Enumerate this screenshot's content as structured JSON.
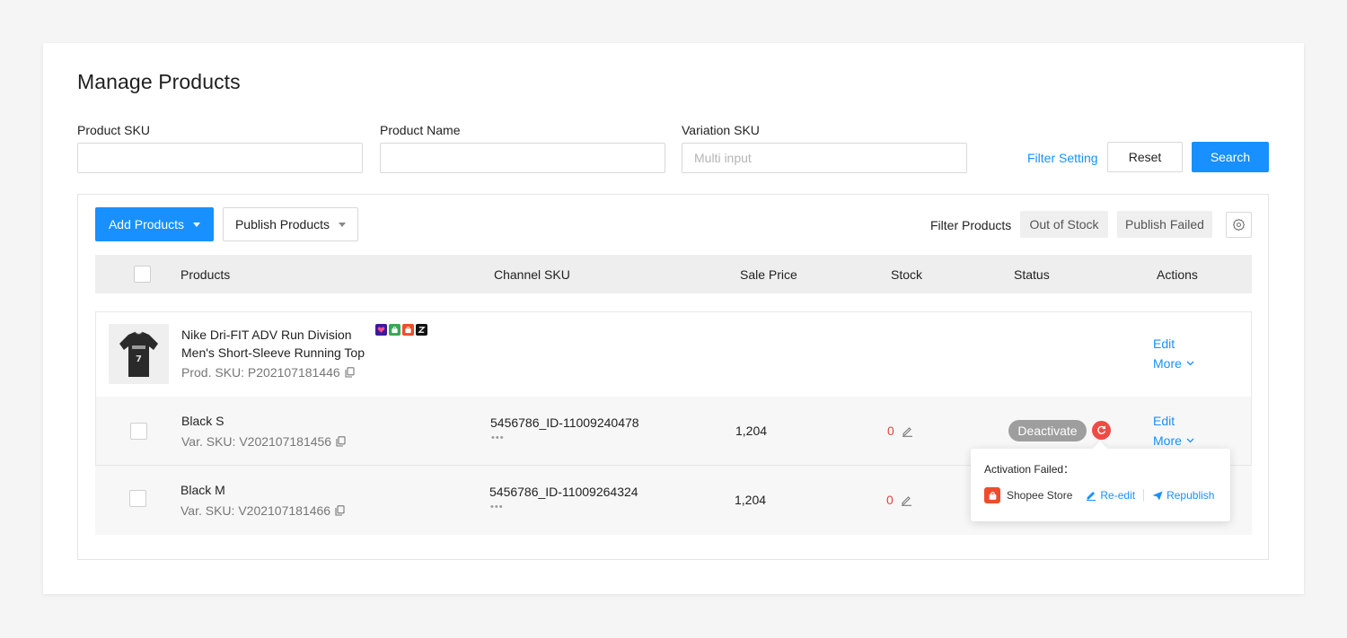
{
  "page": {
    "title": "Manage Products"
  },
  "filters": {
    "product_sku": {
      "label": "Product SKU",
      "value": "",
      "placeholder": ""
    },
    "product_name": {
      "label": "Product Name",
      "value": "",
      "placeholder": ""
    },
    "variation_sku": {
      "label": "Variation SKU",
      "value": "",
      "placeholder": "Multi input"
    },
    "filter_setting": "Filter Setting",
    "reset": "Reset",
    "search": "Search"
  },
  "toolbar": {
    "add_products": "Add Products",
    "publish_products": "Publish Products",
    "filter_label": "Filter Products",
    "chips": [
      "Out of Stock",
      "Publish Failed"
    ]
  },
  "table": {
    "columns": [
      "Products",
      "Channel SKU",
      "Sale Price",
      "Stock",
      "Status",
      "Actions"
    ]
  },
  "product": {
    "name_line1": "Nike Dri-FIT ADV Run Division",
    "name_line2": "Men's Short-Sleeve Running Top",
    "sku": "Prod. SKU: P202107181446",
    "channels": [
      "lazada-icon",
      "shop-bag-icon",
      "shopee-icon",
      "zalora-icon"
    ],
    "edit": "Edit",
    "more": "More"
  },
  "variations": [
    {
      "name": "Black S",
      "sku": "Var. SKU: V202107181456",
      "channel_sku": "5456786_ID-11009240478",
      "price": "1,204",
      "stock": "0",
      "status": "Deactivate",
      "edit": "Edit",
      "more": "More"
    },
    {
      "name": "Black M",
      "sku": "Var. SKU: V202107181466",
      "channel_sku": "5456786_ID-11009264324",
      "price": "1,204",
      "stock": "0"
    }
  ],
  "popover": {
    "title": "Activation Failed：",
    "store": "Shopee Store",
    "reedit": "Re-edit",
    "republish": "Republish"
  },
  "colors": {
    "primary": "#1890ff",
    "danger": "#e8413c",
    "shopee": "#ee4d2d"
  }
}
